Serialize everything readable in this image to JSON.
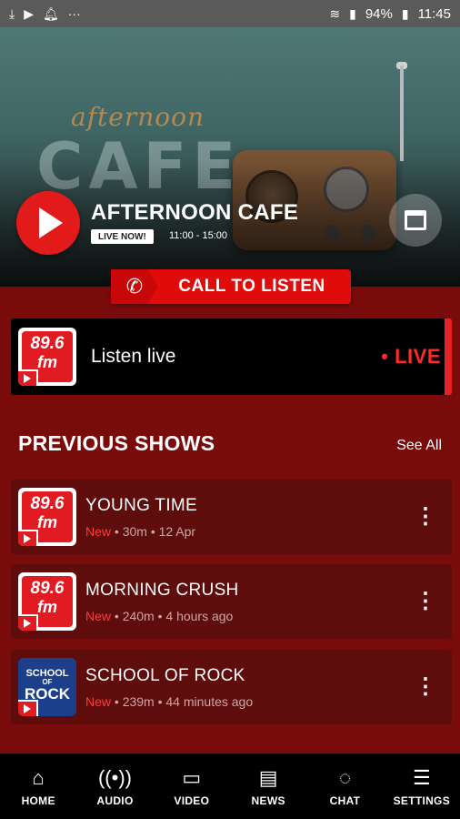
{
  "status_bar": {
    "battery": "94%",
    "time": "11:45",
    "left_icons": [
      "download-icon",
      "media-icon",
      "notification-bell-icon",
      "more-dots-icon"
    ],
    "right_icons": [
      "wifi-icon",
      "signal-icon",
      "battery-icon"
    ]
  },
  "hero": {
    "logo_script": "afternoon",
    "logo_big": "CAFE",
    "show_title": "AFTERNOON CAFE",
    "live_badge": "LIVE NOW!",
    "time_range": "11:00 - 15:00",
    "play_icon": "play-icon",
    "calendar_icon": "calendar-icon"
  },
  "call": {
    "label": "CALL TO LISTEN",
    "icon": "phone-icon"
  },
  "live": {
    "station_top": "89.6",
    "station_bottom": "fm",
    "label": "Listen live",
    "badge": "• LIVE"
  },
  "previous": {
    "title": "PREVIOUS SHOWS",
    "see_all": "See All",
    "shows": [
      {
        "name": "YOUNG TIME",
        "tag": "New",
        "meta": " • 30m • 12 Apr",
        "logo": "89.6 fm"
      },
      {
        "name": "MORNING CRUSH",
        "tag": "New",
        "meta": " • 240m • 4 hours ago",
        "logo": "89.6 fm"
      },
      {
        "name": "SCHOOL OF ROCK",
        "tag": "New",
        "meta": " • 239m • 44 minutes ago",
        "logo": "school of rock"
      }
    ],
    "logo_rock": {
      "l1": "SCHOOL",
      "l2": "OF",
      "l3": "ROCK"
    }
  },
  "nav": {
    "items": [
      {
        "label": "HOME",
        "icon": "home-icon"
      },
      {
        "label": "AUDIO",
        "icon": "audio-icon"
      },
      {
        "label": "VIDEO",
        "icon": "video-icon"
      },
      {
        "label": "NEWS",
        "icon": "news-icon"
      },
      {
        "label": "CHAT",
        "icon": "chat-icon"
      },
      {
        "label": "SETTINGS",
        "icon": "settings-icon"
      }
    ]
  },
  "colors": {
    "accent_red": "#e21a1a",
    "background": "#7a0b0b",
    "card": "#5e0c0c",
    "live_red": "#ff2b2b"
  }
}
